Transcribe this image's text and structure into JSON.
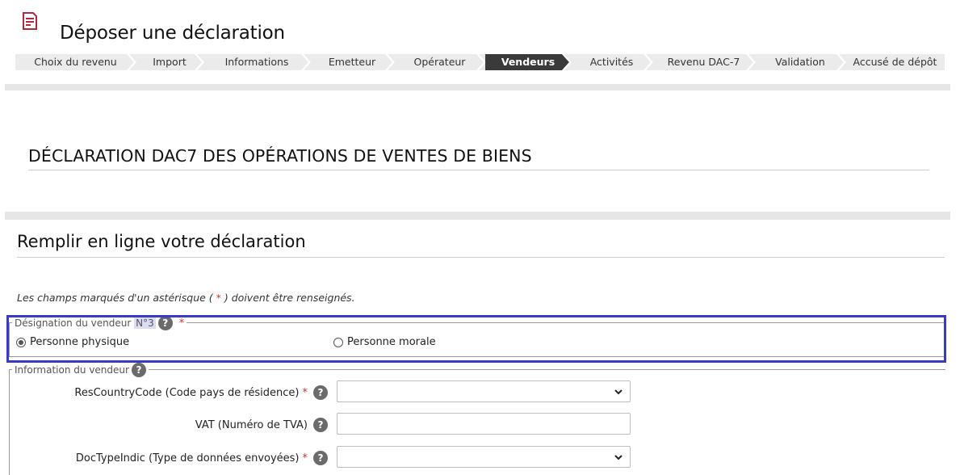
{
  "header": {
    "title": "Déposer une déclaration",
    "icon": "document-icon"
  },
  "steps": [
    {
      "label": "Choix du revenu",
      "active": false
    },
    {
      "label": "Import",
      "active": false
    },
    {
      "label": "Informations",
      "active": false
    },
    {
      "label": "Emetteur",
      "active": false
    },
    {
      "label": "Opérateur",
      "active": false
    },
    {
      "label": "Vendeurs",
      "active": true
    },
    {
      "label": "Activités",
      "active": false
    },
    {
      "label": "Revenu DAC-7",
      "active": false
    },
    {
      "label": "Validation",
      "active": false
    },
    {
      "label": "Accusé de dépôt",
      "active": false
    }
  ],
  "main": {
    "heading": "DÉCLARATION DAC7 DES OPÉRATIONS DE VENTES DE BIENS",
    "form_heading": "Remplir en ligne votre déclaration",
    "required_note_prefix": "Les champs marqués d'un astérisque (",
    "required_note_star": " * ",
    "required_note_suffix": ") doivent être renseignés."
  },
  "designation": {
    "legend": "Désignation du vendeur",
    "legend_highlight": "N°3",
    "help": "?",
    "required": "*",
    "options": [
      {
        "label": "Personne physique",
        "checked": true
      },
      {
        "label": "Personne morale",
        "checked": false
      }
    ]
  },
  "information": {
    "legend": "Information du vendeur",
    "help": "?",
    "fields": [
      {
        "label": "ResCountryCode (Code pays de résidence)",
        "required": "*",
        "type": "select",
        "value": ""
      },
      {
        "label": "VAT (Numéro de TVA)",
        "required": "",
        "type": "text",
        "value": ""
      },
      {
        "label": "DocTypeIndic (Type de données envoyées)",
        "required": "*",
        "type": "select",
        "value": ""
      }
    ]
  },
  "colors": {
    "accent_border": "#3a3ac8",
    "required_star": "#c0392b",
    "active_step": "#3a3a3a",
    "doc_icon": "#b5283e"
  }
}
